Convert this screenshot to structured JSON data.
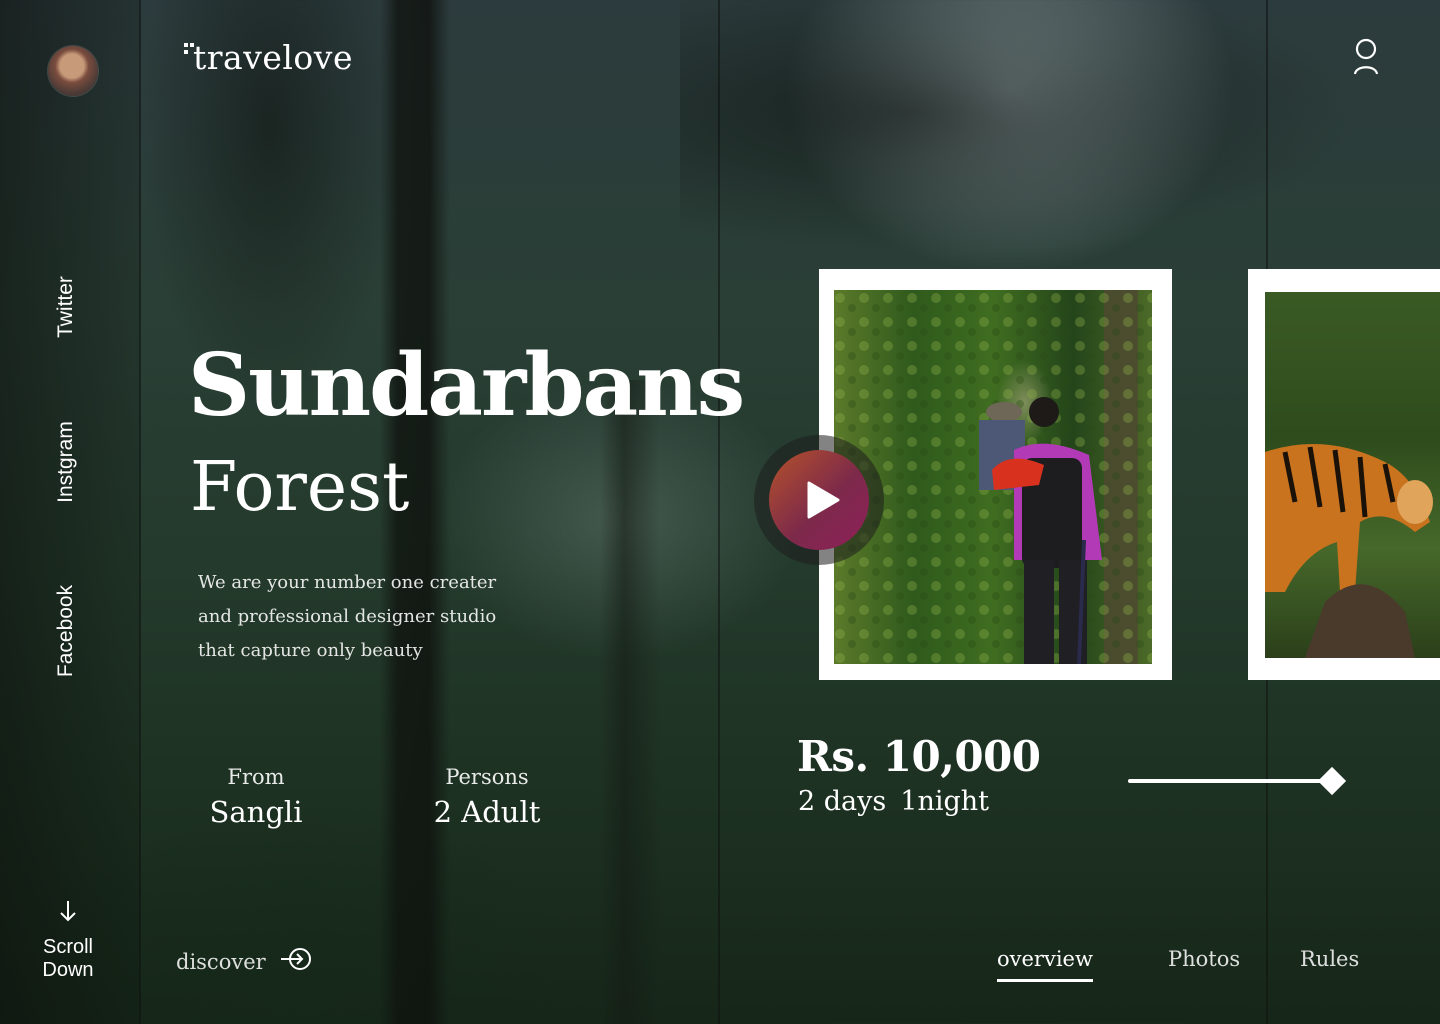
{
  "brand": {
    "name": "travelove"
  },
  "social": [
    "Twitter",
    "Instgram",
    "Facebook"
  ],
  "scroll": {
    "line1": "Scroll",
    "line2": "Down"
  },
  "hero": {
    "title": "Sundarbans",
    "subtitle": "Forest",
    "description": [
      "We are your number one creater",
      "and professional designer studio",
      "that capture only beauty"
    ]
  },
  "trip": {
    "from_label": "From",
    "from_value": "Sangli",
    "persons_label": "Persons",
    "persons_value": "2 Adult",
    "price": "Rs. 10,000",
    "days": "2 days",
    "nights": "1night",
    "progress": 0.95
  },
  "discover_label": "discover",
  "tabs": [
    {
      "label": "overview",
      "active": true
    },
    {
      "label": "Photos",
      "active": false
    },
    {
      "label": "Rules",
      "active": false
    }
  ],
  "colors": {
    "accent_start": "#b5522a",
    "accent_end": "#8e1f5a",
    "text": "#ffffff"
  },
  "icons": [
    "user-icon",
    "play-icon",
    "arrow-down-icon",
    "discover-arrow-icon",
    "logo-dots-icon"
  ]
}
